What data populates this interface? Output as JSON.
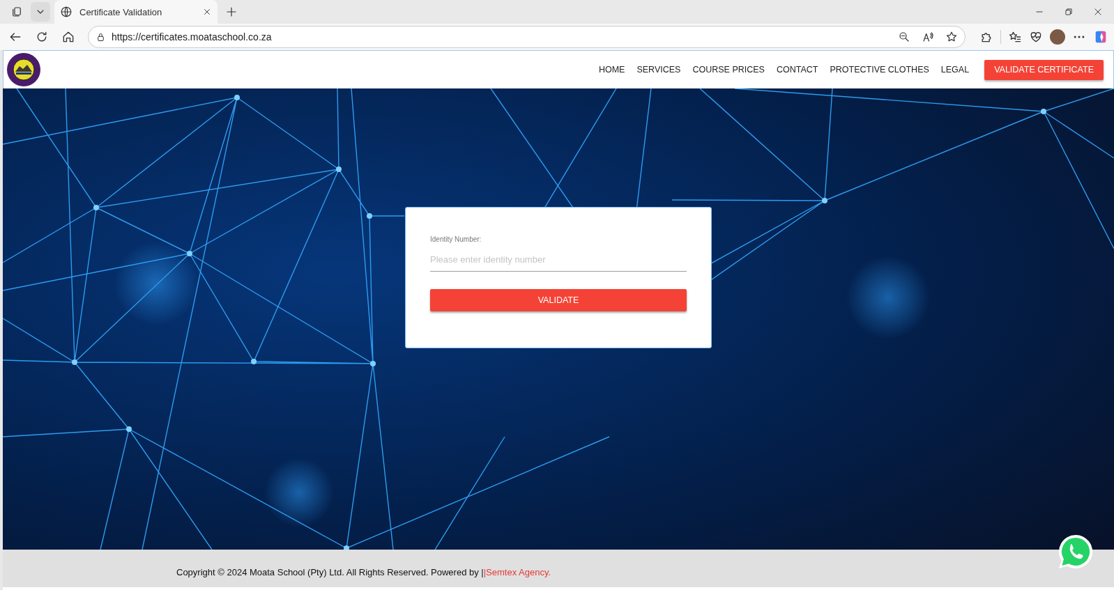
{
  "browser": {
    "tab_title": "Certificate Validation",
    "url": "https://certificates.moataschool.co.za"
  },
  "nav": {
    "links": [
      {
        "label": "HOME"
      },
      {
        "label": "SERVICES"
      },
      {
        "label": "COURSE PRICES"
      },
      {
        "label": "CONTACT"
      },
      {
        "label": "PROTECTIVE CLOTHES"
      },
      {
        "label": "LEGAL"
      }
    ],
    "cta": "VALIDATE CERTIFICATE"
  },
  "form": {
    "label": "Identity Number:",
    "placeholder": "Please enter identity number",
    "button": "VALIDATE"
  },
  "footer": {
    "text": "Copyright © 2024 Moata School (Pty) Ltd. All Rights Reserved. Powered by |",
    "link": "|Semtex Agency."
  }
}
